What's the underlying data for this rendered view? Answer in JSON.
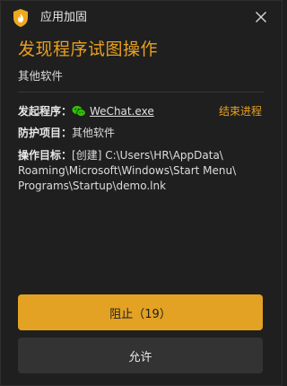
{
  "window": {
    "title": "应用加固",
    "icon": "shield-flame-icon",
    "close_icon": "close-icon"
  },
  "alert": {
    "headline": "发现程序试图操作",
    "category": "其他软件"
  },
  "details": {
    "launcher_label": "发起程序：",
    "launcher_icon": "wechat-icon",
    "launcher_name": "WeChat.exe",
    "end_process_label": "结束进程",
    "protect_label": "防护项目：",
    "protect_value": "其他软件",
    "target_label": "操作目标：",
    "target_path_lines": [
      "[创建] C:\\Users\\HR\\AppData\\",
      "Roaming\\Microsoft\\Windows\\Start Menu\\",
      "Programs\\Startup\\demo.lnk"
    ]
  },
  "actions": {
    "block_label": "阻止（19）",
    "allow_label": "允许"
  },
  "colors": {
    "accent": "#e8a020",
    "block_button": "#e3a223",
    "allow_button": "#333333",
    "background": "#1f1f1f"
  }
}
